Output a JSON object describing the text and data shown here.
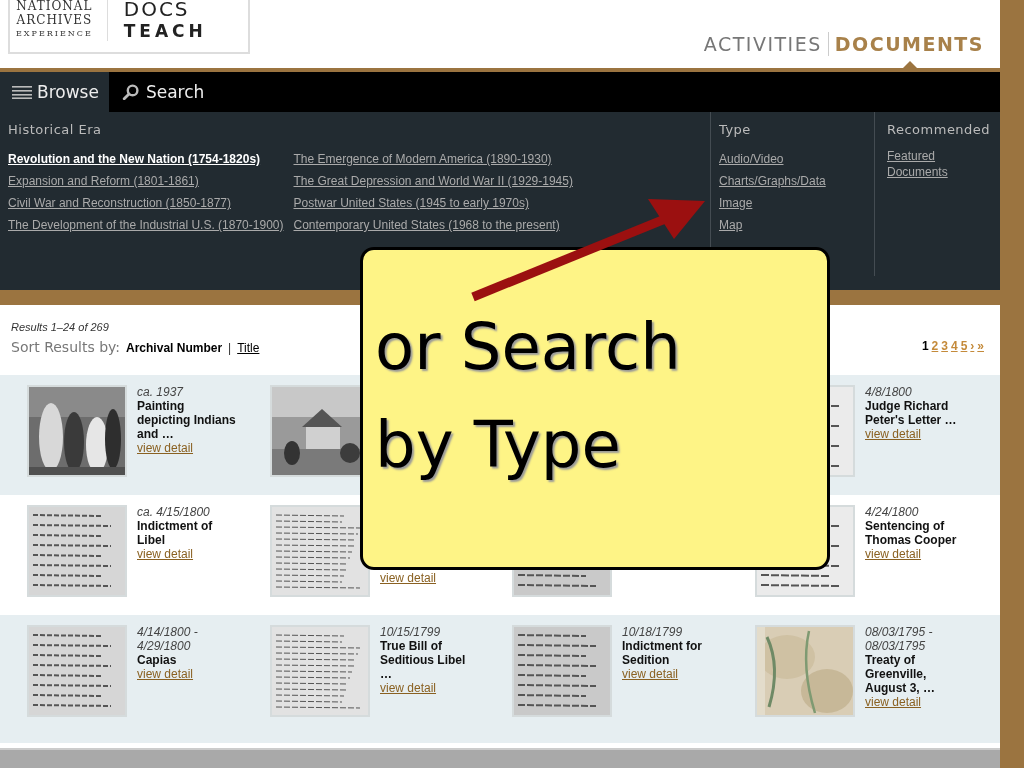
{
  "logo": {
    "left_lines": [
      "NATIONAL",
      "ARCHIVES",
      "EXPERIENCE"
    ],
    "right_lines": [
      "DOCS",
      "TEACH"
    ]
  },
  "main_nav": [
    {
      "label": "ACTIVITIES",
      "selected": false
    },
    {
      "label": "DOCUMENTS",
      "selected": true
    }
  ],
  "tabs": [
    {
      "label": "Browse",
      "selected": true
    },
    {
      "label": "Search",
      "selected": false
    }
  ],
  "browse_panel": {
    "era": {
      "heading": "Historical Era",
      "columns": [
        [
          {
            "label": "Revolution and the New Nation (1754-1820s)",
            "selected": true
          },
          {
            "label": "Expansion and Reform (1801-1861)",
            "selected": false
          },
          {
            "label": "Civil War and Reconstruction (1850-1877)",
            "selected": false
          },
          {
            "label": "The Development of the Industrial U.S. (1870-1900)",
            "selected": false
          }
        ],
        [
          {
            "label": "The Emergence of Modern America (1890-1930)",
            "selected": false
          },
          {
            "label": "The Great Depression and World War II (1929-1945)",
            "selected": false
          },
          {
            "label": "Postwar United States (1945 to early 1970s)",
            "selected": false
          },
          {
            "label": "Contemporary United States (1968 to the present)",
            "selected": false
          }
        ]
      ]
    },
    "type": {
      "heading": "Type",
      "items": [
        "Audio/Video",
        "Charts/Graphs/Data",
        "Image",
        "Map"
      ]
    },
    "recommended": {
      "heading": "Recommended",
      "items": [
        "Featured Documents"
      ]
    }
  },
  "results": {
    "count": "Results 1–24 of 269",
    "sort_label": "Sort Results by:",
    "sort_separator": "|",
    "sort_options": [
      {
        "label": "Archival Number",
        "selected": true
      },
      {
        "label": "Title",
        "selected": false
      }
    ],
    "pagination": [
      {
        "label": "1",
        "selected": true
      },
      {
        "label": "2",
        "selected": false
      },
      {
        "label": "3",
        "selected": false
      },
      {
        "label": "4",
        "selected": false
      },
      {
        "label": "5",
        "selected": false
      },
      {
        "label": "›",
        "selected": false
      },
      {
        "label": "»",
        "selected": false
      }
    ],
    "rows": [
      {
        "items": [
          {
            "kind": "picture",
            "date": "ca. 1937",
            "title": "Painting depicting Indians and …",
            "link": "view detail"
          },
          {
            "kind": "picture"
          },
          {
            "kind": "picture",
            "date": "4/8/1800",
            "title": "Judge Richard Peter's Letter …",
            "link": "view detail"
          }
        ]
      },
      {
        "items": [
          {
            "kind": "picture",
            "date": "ca. 4/15/1800",
            "title": "Indictment of Libel",
            "link": "view detail"
          },
          {
            "kind": "picture",
            "link": "view detail"
          },
          {
            "kind": "picture"
          },
          {
            "kind": "picture",
            "date": "4/24/1800",
            "title": "Sentencing of Thomas Cooper",
            "link": "view detail"
          }
        ]
      },
      {
        "items": [
          {
            "kind": "picture",
            "date": "4/14/1800 - 4/29/1800",
            "title": "Capias",
            "link": "view detail"
          },
          {
            "kind": "picture",
            "date": "10/15/1799",
            "title": "True Bill of Seditious Libel …",
            "link": "view detail"
          },
          {
            "kind": "picture",
            "date": "10/18/1799",
            "title": "Indictment for Sedition",
            "link": "view detail"
          },
          {
            "kind": "picture",
            "date": "08/03/1795 - 08/03/1795",
            "title": "Treaty of Greenville, August 3, …",
            "link": "view detail"
          }
        ]
      }
    ]
  },
  "callout": {
    "text": "or Search by Type"
  }
}
